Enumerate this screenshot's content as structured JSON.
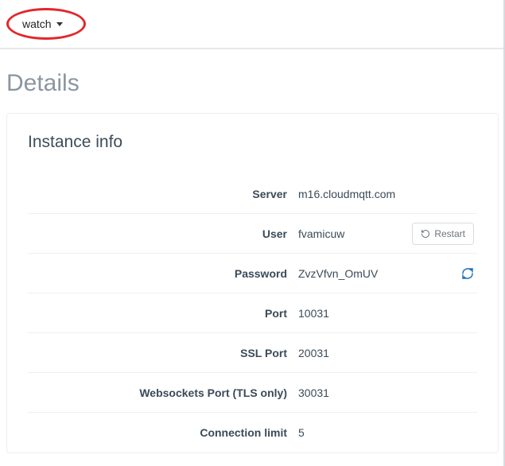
{
  "dropdown": {
    "label": "watch"
  },
  "page_title": "Details",
  "card_title": "Instance info",
  "labels": {
    "server": "Server",
    "user": "User",
    "password": "Password",
    "port": "Port",
    "ssl_port": "SSL Port",
    "ws_port": "Websockets Port (TLS only)",
    "conn_limit": "Connection limit"
  },
  "values": {
    "server": "m16.cloudmqtt.com",
    "user": "fvamicuw",
    "password": "ZvzVfvn_OmUV",
    "port": "10031",
    "ssl_port": "20031",
    "ws_port": "30031",
    "conn_limit": "5"
  },
  "buttons": {
    "restart": "Restart"
  }
}
